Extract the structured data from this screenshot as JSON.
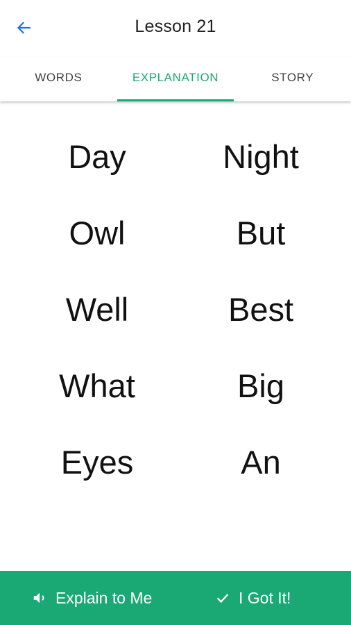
{
  "header": {
    "title": "Lesson 21",
    "back_icon": "arrow-left-icon",
    "accent_color": "#1a73e8"
  },
  "tabs": [
    {
      "label": "WORDS",
      "active": false
    },
    {
      "label": "EXPLANATION",
      "active": true
    },
    {
      "label": "STORY",
      "active": false
    }
  ],
  "theme": {
    "primary": "#1aa874"
  },
  "word_pairs": [
    {
      "left": "Day",
      "right": "Night"
    },
    {
      "left": "Owl",
      "right": "But"
    },
    {
      "left": "Well",
      "right": "Best"
    },
    {
      "left": "What",
      "right": "Big"
    },
    {
      "left": "Eyes",
      "right": "An"
    }
  ],
  "actions": {
    "explain_label": "Explain to Me",
    "explain_icon": "speaker-icon",
    "gotit_label": "I Got It!",
    "gotit_icon": "check-icon"
  }
}
